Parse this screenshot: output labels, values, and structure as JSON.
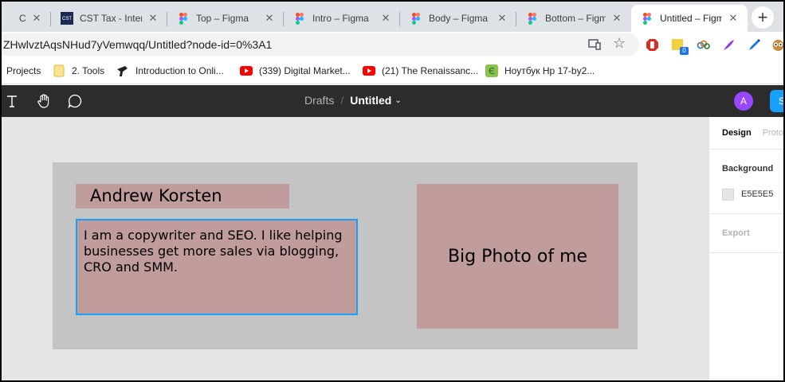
{
  "browser": {
    "tabs": [
      {
        "label": "Consultant l",
        "icon": "generic-tab-icon",
        "active": false
      },
      {
        "label": "CST Tax - Intern",
        "icon": "cst-logo-icon",
        "active": false
      },
      {
        "label": "Top – Figma",
        "icon": "figma-icon",
        "active": false
      },
      {
        "label": "Intro – Figma",
        "icon": "figma-icon",
        "active": false
      },
      {
        "label": "Body – Figma",
        "icon": "figma-icon",
        "active": false
      },
      {
        "label": "Bottom – Figma",
        "icon": "figma-icon",
        "active": false
      },
      {
        "label": "Untitled – Figma",
        "icon": "figma-icon",
        "active": true
      }
    ],
    "new_tab": "+",
    "close_glyph": "✕",
    "url": "ZHwlvztAqsNHud7yVemwqq/Untitled?node-id=0%3A1",
    "extension_badge": "0",
    "bookmarks": [
      {
        "label": "Projects",
        "icon": "none"
      },
      {
        "label": "2. Tools",
        "icon": "folder-icon"
      },
      {
        "label": "Introduction to Onli...",
        "icon": "bookmark-icon"
      },
      {
        "label": "(339) Digital Market...",
        "icon": "youtube-icon"
      },
      {
        "label": "(21) The Renaissanc...",
        "icon": "youtube-icon"
      },
      {
        "label": "Ноутбук Hp 17-by2...",
        "icon": "store-icon"
      }
    ]
  },
  "figma": {
    "breadcrumb_parent": "Drafts",
    "breadcrumb_sep": "/",
    "file_name": "Untitled",
    "chevron": "⌄",
    "avatar_initial": "A",
    "share_label": "S"
  },
  "canvas": {
    "name_text": "Andrew Korsten",
    "bio_text": "I am a copywriter and SEO. I like helping businesses get more sales via blogging, CRO and SMM.",
    "photo_text": "Big Photo of me"
  },
  "panel": {
    "tab_design": "Design",
    "tab_prototype": "Proto",
    "background_title": "Background",
    "background_hex": "E5E5E5",
    "export_title": "Export"
  },
  "colors": {
    "figma_toolbar": "#2c2c2c",
    "canvas_bg": "#e5e5e5",
    "frame_bg": "#c4c4c4",
    "box_fill": "#c09c9c",
    "selection_blue": "#18a0fb",
    "avatar": "#9747ff"
  }
}
